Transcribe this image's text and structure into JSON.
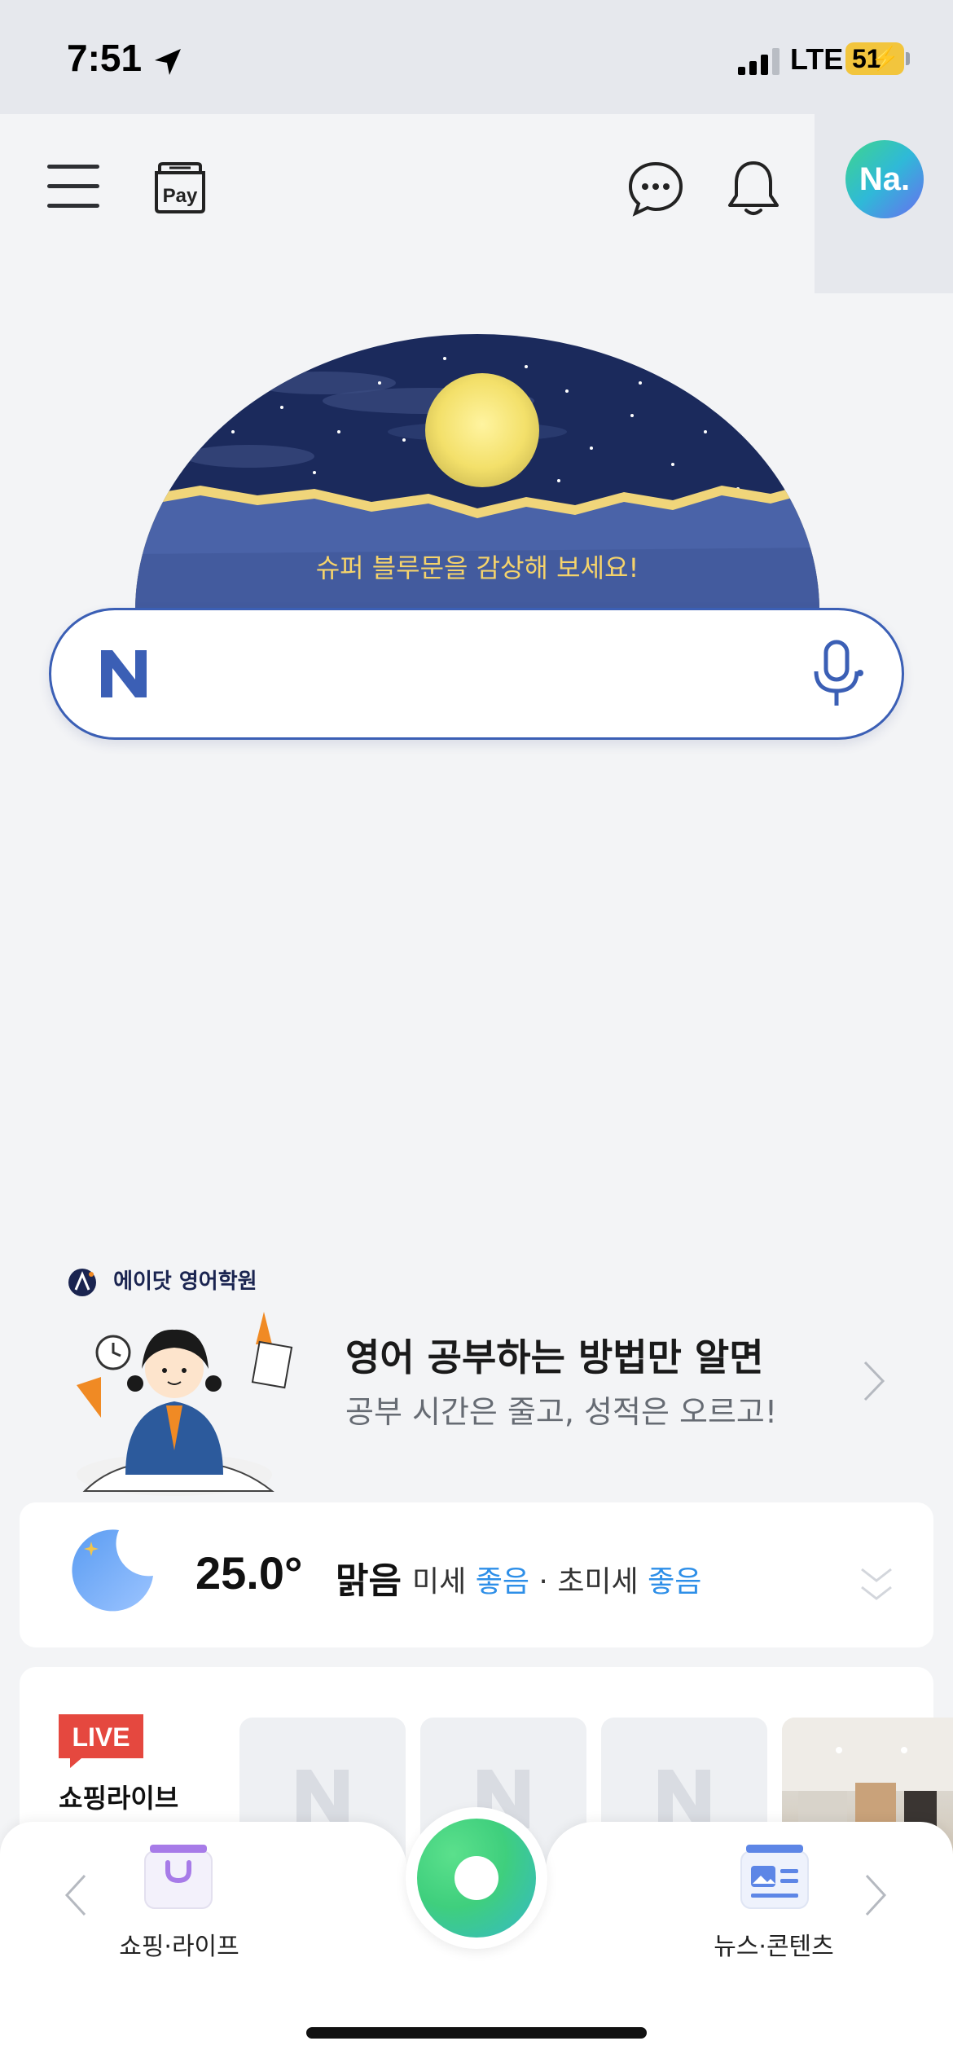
{
  "status_bar": {
    "time": "7:51",
    "network": "LTE",
    "battery": "51",
    "icons": [
      "location-arrow-icon",
      "signal-icon",
      "battery-icon"
    ]
  },
  "header": {
    "pay_label": "Pay",
    "avatar_text": "Na.",
    "icons": [
      "menu-icon",
      "pay-icon",
      "chat-icon",
      "bell-icon"
    ]
  },
  "doodle": {
    "caption": "슈퍼 블루문을 감상해 보세요!"
  },
  "search": {
    "placeholder": "",
    "value": ""
  },
  "ad": {
    "brand": "에이닷 영어학원",
    "title": "영어 공부하는 방법만 알면",
    "subtitle": "공부 시간은 줄고, 성적은 오르고!"
  },
  "weather": {
    "temperature": "25.0°",
    "condition": "맑음",
    "fine_dust_label": "미세",
    "fine_dust_value": "좋음",
    "separator": "·",
    "ultrafine_dust_label": "초미세",
    "ultrafine_dust_value": "좋음"
  },
  "shopping_live": {
    "badge": "LIVE",
    "title": "쇼핑라이브"
  },
  "bottom_nav": {
    "left_label": "쇼핑·라이프",
    "right_label": "뉴스·콘텐츠"
  },
  "colors": {
    "accent_blue": "#3b5fb5",
    "good_status": "#2e8fe8",
    "green_button": "#3fcf7d",
    "live_red": "#e5483f",
    "battery_yellow": "#f2c53d"
  }
}
